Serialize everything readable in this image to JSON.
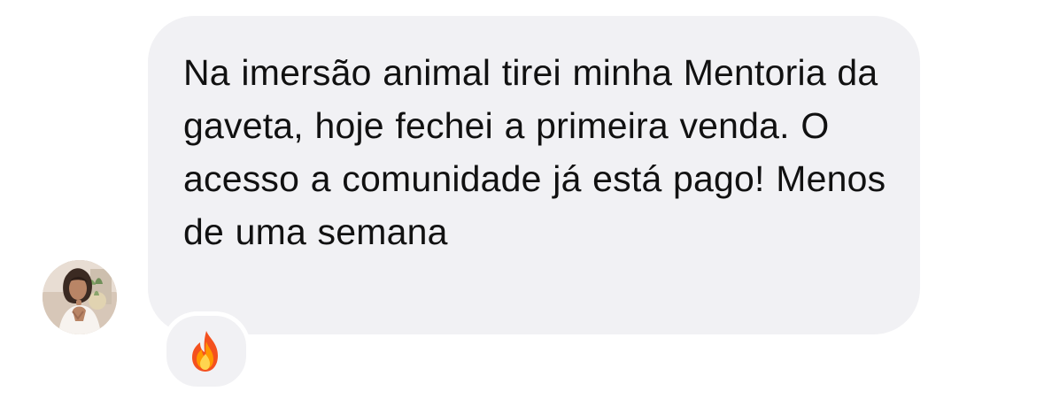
{
  "message": {
    "text": "Na imersão animal tirei minha Mentoria da gaveta, hoje fechei a primeira venda. O acesso a comunidade já está pago! Menos de uma semana",
    "bubble_color": "#f1f1f4",
    "text_color": "#111111"
  },
  "sender": {
    "avatar_icon": "avatar-photo"
  },
  "reaction": {
    "icon": "fire-icon"
  }
}
